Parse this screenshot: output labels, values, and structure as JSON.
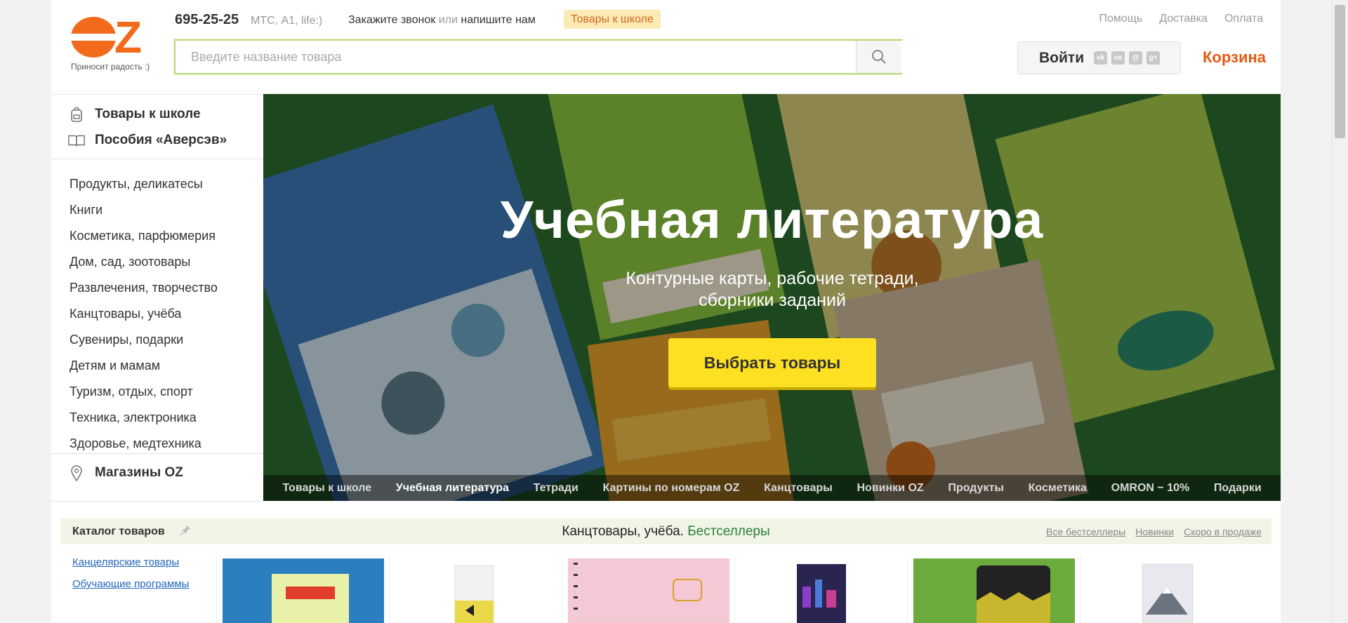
{
  "header": {
    "logo_tagline": "Приносит радость :)",
    "phone": "695-25-25",
    "phone_operators": "МТС, А1, life:)",
    "call_order": "Закажите звонок",
    "call_or": "или",
    "call_write": "напишите нам",
    "school_badge": "Товары к школе",
    "top_links": [
      "Помощь",
      "Доставка",
      "Оплата"
    ],
    "search_placeholder": "Введите название товара",
    "login_label": "Войти",
    "social_icons": [
      "vk-icon",
      "ok-icon",
      "mailru-icon",
      "google-plus-icon"
    ],
    "cart_label": "Корзина",
    "brand_color": "#f26b1d"
  },
  "sidebar": {
    "favorites": [
      {
        "label": "Товары к школе",
        "icon": "backpack-icon"
      },
      {
        "label": "Пособия «Аверсэв»",
        "icon": "book-icon"
      }
    ],
    "categories": [
      "Продукты, деликатесы",
      "Книги",
      "Косметика, парфюмерия",
      "Дом, сад, зоотовары",
      "Развлечения, творчество",
      "Канцтовары, учёба",
      "Сувениры, подарки",
      "Детям и мамам",
      "Туризм, отдых, спорт",
      "Техника, электроника",
      "Здоровье, медтехника"
    ],
    "stores": "Магазины OZ"
  },
  "hero": {
    "title": "Учебная литература",
    "subtitle": "Контурные карты, рабочие тетради, сборники заданий",
    "button": "Выбрать товары",
    "tabs": [
      "Товары к школе",
      "Учебная литература",
      "Тетради",
      "Картины по номерам OZ",
      "Канцтовары",
      "Новинки OZ",
      "Продукты",
      "Косметика",
      "OMRON − 10%",
      "Подарки"
    ],
    "active_tab": "Учебная литература"
  },
  "catalog": {
    "label": "Каталог товаров",
    "title_main": "Канцтовары, учёба.",
    "title_accent": "Бестселлеры",
    "links": [
      "Все бестселлеры",
      "Новинки",
      "Скоро в продаже"
    ],
    "sub_links": [
      "Канцелярские товары",
      "Обучающие программы"
    ]
  },
  "products": [
    "product-cardboard",
    "product-eraser",
    "product-notebook-pink",
    "product-notebook-city",
    "product-pencils",
    "product-notebook-fuji"
  ]
}
